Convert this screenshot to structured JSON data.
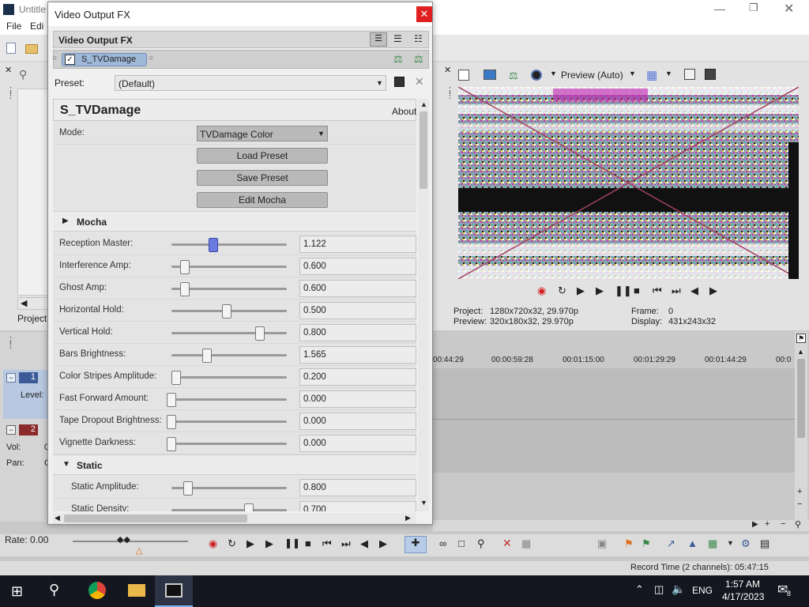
{
  "main_window": {
    "title": "Untitle",
    "menu": [
      "File",
      "Edi"
    ],
    "project_label": "Project",
    "rate_label": "Rate: 0.00",
    "record_time": "Record Time (2 channels): 05:47:15"
  },
  "preview": {
    "quality": "Preview (Auto)",
    "project_label": "Project:",
    "project_value": "1280x720x32, 29.970p",
    "preview_label": "Preview:",
    "preview_value": "320x180x32, 29.970p",
    "frame_label": "Frame:",
    "frame_value": "0",
    "display_label": "Display:",
    "display_value": "431x243x32"
  },
  "timeline": {
    "ticks": [
      "00:44:29",
      "00:00:59:28",
      "00:01:15:00",
      "00:01:29:29",
      "00:01:44:29",
      "00:0"
    ],
    "track1_number": "1",
    "track1_level_label": "Level:",
    "track2_number": "2",
    "track2_vol_label": "Vol:",
    "track2_pan_label": "Pan:",
    "track2_vol_value": "0",
    "track2_pan_value": "C"
  },
  "dialog": {
    "title": "Video Output FX",
    "header_label": "Video Output FX",
    "chain_item": "S_TVDamage",
    "preset_label": "Preset:",
    "preset_value": "(Default)",
    "plugin_name": "S_TVDamage",
    "about_label": "About",
    "mode_label": "Mode:",
    "mode_value": "TVDamage Color",
    "buttons": {
      "load_preset": "Load Preset",
      "save_preset": "Save Preset",
      "edit_mocha": "Edit Mocha"
    },
    "mocha_section": "Mocha",
    "static_section": "Static",
    "params": [
      {
        "label": "Reception Master:",
        "value": "1.122",
        "level": 0.38
      },
      {
        "label": "Interference Amp:",
        "value": "0.600",
        "level": 0.12
      },
      {
        "label": "Ghost Amp:",
        "value": "0.600",
        "level": 0.12
      },
      {
        "label": "Horizontal Hold:",
        "value": "0.500",
        "level": 0.5
      },
      {
        "label": "Vertical Hold:",
        "value": "0.800",
        "level": 0.8
      },
      {
        "label": "Bars Brightness:",
        "value": "1.565",
        "level": 0.32
      },
      {
        "label": "Color Stripes Amplitude:",
        "value": "0.200",
        "level": 0.04
      },
      {
        "label": "Fast Forward Amount:",
        "value": "0.000",
        "level": 0.0
      },
      {
        "label": "Tape Dropout Brightness:",
        "value": "0.000",
        "level": 0.0
      },
      {
        "label": "Vignette Darkness:",
        "value": "0.000",
        "level": 0.0
      }
    ],
    "static_params": [
      {
        "label": "Static Amplitude:",
        "value": "0.800",
        "level": 0.15
      },
      {
        "label": "Static Density:",
        "value": "0.700",
        "level": 0.7
      }
    ]
  },
  "taskbar": {
    "language": "ENG",
    "time": "1:57 AM",
    "date": "4/17/2023",
    "notifications": "8"
  },
  "colors": {
    "accent_blue": "#9fb8d8",
    "close_red": "#e02020",
    "taskbar_bg": "#14171f"
  }
}
